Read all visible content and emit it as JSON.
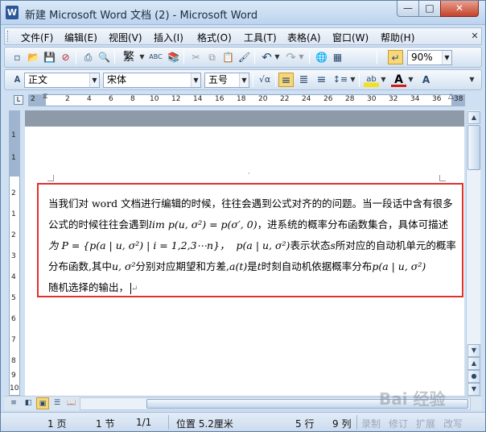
{
  "window": {
    "title": "新建 Microsoft Word 文档 (2) - Microsoft Word",
    "app_icon": "W",
    "min_glyph": "—",
    "max_glyph": "□",
    "close_glyph": "✕"
  },
  "menu": {
    "items": [
      "文件(F)",
      "编辑(E)",
      "视图(V)",
      "插入(I)",
      "格式(O)",
      "工具(T)",
      "表格(A)",
      "窗口(W)",
      "帮助(H)"
    ],
    "close_doc_glyph": "✕"
  },
  "toolbar_standard": {
    "icons": [
      "new-icon",
      "open-icon",
      "save-icon",
      "permission-icon",
      "print-icon",
      "print-preview-icon",
      "traditional-chinese-icon",
      "spelling-icon",
      "research-icon",
      "cut-icon",
      "copy-icon",
      "paste-icon",
      "format-painter-icon",
      "undo-icon",
      "redo-icon",
      "hyperlink-icon",
      "tables-borders-icon",
      "show-hide-icon"
    ],
    "glyphs": {
      "new": "▫",
      "open": "📂",
      "save": "💾",
      "permission": "⊘",
      "print": "⎙",
      "preview": "🔍",
      "traditional": "繁",
      "spelling": "ABC",
      "research": "📚",
      "cut": "✂",
      "copy": "⧉",
      "paste": "📋",
      "painter": "🖌",
      "undo": "↶",
      "redo": "↷",
      "hyperlink": "🌐",
      "tables": "▦",
      "showhide": "↵"
    },
    "zoom": "90%"
  },
  "toolbar_format": {
    "style": "正文",
    "font": "宋体",
    "size": "五号",
    "glyphs": {
      "equation": "√α",
      "align_left": "≡",
      "center": "≣",
      "align_right": "≡",
      "line_spacing": "↕≡",
      "highlight": "ab",
      "font_color": "A"
    }
  },
  "ruler": {
    "h_numbers": [
      "2",
      "2",
      "4",
      "6",
      "8",
      "10",
      "12",
      "14",
      "16",
      "18",
      "20",
      "22",
      "24",
      "26",
      "28",
      "30",
      "32",
      "34",
      "36",
      "38"
    ],
    "v_numbers": [
      "1",
      "1",
      "2",
      "1",
      "2",
      "3",
      "4",
      "5",
      "6",
      "7",
      "8",
      "9",
      "10"
    ]
  },
  "document": {
    "line1": "当我们对 word 文档进行编辑的时候，往往会遇到公式对齐的的问题。当一段话中含有很多",
    "line2_a": "公式的时候往往会遇到",
    "line2_math": "lim p(u, σ²) = p(σ′, 0)",
    "line2_b": "，进系统的概率分布函数集合，具体可描述",
    "line3_a": "为 P = {p(a | u, σ²) | i = 1,2,3⋯n}，",
    "line3_math": "p(a | u, σ²)",
    "line3_b": "表示状态",
    "line3_c": "所对应的自动机单元的概率",
    "line3_s": "s",
    "line4_a": "分布函数,其中",
    "line4_math": "u, σ²",
    "line4_b": "分别对应期望和方差,",
    "line4_at": "a(t)",
    "line4_c": "是",
    "line4_t": "t",
    "line4_d": "时刻自动机依据概率分布",
    "line4_math2": "p(a | u, σ²)",
    "line5": "随机选择的输出，"
  },
  "statusbar": {
    "page": "1 页",
    "section": "1 节",
    "page_of": "1/1",
    "position": "位置 5.2厘米",
    "line": "5 行",
    "column": "9 列",
    "rec": "录制",
    "trk": "修订",
    "ext": "扩展",
    "ovr": "改写"
  },
  "watermark": "Bai 经验"
}
